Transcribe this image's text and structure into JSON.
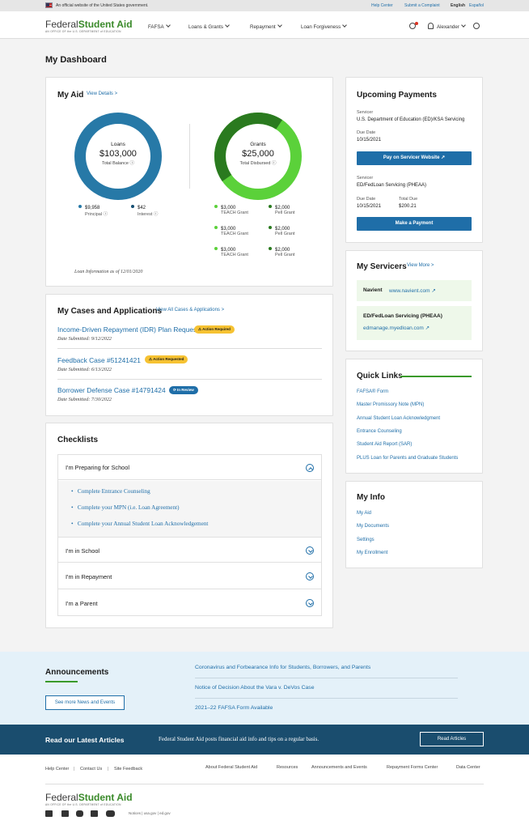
{
  "gov_banner": {
    "text": "An official website of the United States government.",
    "help": "Help Center",
    "complaint": "Submit a Complaint",
    "english": "English",
    "espanol": "Español"
  },
  "nav": {
    "logo_a": "Federal",
    "logo_b": "Student Aid",
    "logo_sub": "AN OFFICE OF the U.S. DEPARTMENT of EDUCATION",
    "items": [
      "FAFSA",
      "Loans & Grants",
      "Repayment",
      "Loan Forgiveness"
    ],
    "user": "Alexander"
  },
  "page_title": "My Dashboard",
  "my_aid": {
    "title": "My Aid",
    "view_details": "View Details >",
    "loans": {
      "title": "Loans",
      "amount": "$103,000",
      "sub": "Total Balance",
      "principal": "$9,958",
      "principal_l": "Principal",
      "interest": "$42",
      "interest_l": "Interest"
    },
    "grants": {
      "title": "Grants",
      "amount": "$25,000",
      "sub": "Total Disbursed",
      "items": [
        {
          "v": "$3,000",
          "l": "TEACH Grant"
        },
        {
          "v": "$2,000",
          "l": "Pell Grant"
        },
        {
          "v": "$3,000",
          "l": "TEACH Grant"
        },
        {
          "v": "$2,000",
          "l": "Pell Grant"
        },
        {
          "v": "$3,000",
          "l": "TEACH Grant"
        },
        {
          "v": "$2,000",
          "l": "Pell Grant"
        }
      ]
    },
    "info_date": "Loan Information as of 12/01/2020",
    "colors": {
      "loan": "#2779a7",
      "loan_dark": "#164f73",
      "grant_light": "#5bd13a",
      "grant_dark": "#2a7a1f"
    }
  },
  "cases": {
    "title": "My Cases and Applications",
    "view_all": "View All Cases & Applications >",
    "items": [
      {
        "title": "Income-Driven Repayment (IDR) Plan Request",
        "badge": "Action Required",
        "date": "Date Submitted: 9/12/2022"
      },
      {
        "title": "Feedback Case #51241421",
        "badge": "Action Requested",
        "date": "Date Submitted: 6/13/2022"
      },
      {
        "title": "Borrower Defense Case #14791424",
        "badge": "In Review",
        "date": "Date Submitted: 7/30/2022"
      }
    ]
  },
  "checklists": {
    "title": "Checklists",
    "sections": [
      "I'm Preparing for School",
      "I'm in School",
      "I'm in Repayment",
      "I'm a Parent"
    ],
    "items": [
      "Complete Entrance Counseling",
      "Complete your MPN (i.e. Loan Agreement)",
      "Complete your Annual Student Loan Acknowledgement"
    ]
  },
  "payments": {
    "title": "Upcoming Payments",
    "s1_label": "Servicer",
    "s1": "U.S. Department of Education (ED)/KSA Servicing",
    "d1_label": "Due Date",
    "d1": "10/15/2021",
    "btn1": "Pay on Servicer Website",
    "s2_label": "Servicer",
    "s2": "ED/FedLoan Servicing (PHEAA)",
    "d2_label": "Due Date",
    "d2": "10/15/2021",
    "t2_label": "Total Due",
    "t2": "$200.21",
    "btn2": "Make a Payment"
  },
  "servicers": {
    "title": "My Servicers",
    "view_more": "View More >",
    "n1": "Navient",
    "u1": "www.navient.com",
    "n2": "ED/FedLoan Servicing (PHEAA)",
    "u2": "edmanage.myedloan.com"
  },
  "quick_links": {
    "title": "Quick Links",
    "items": [
      "FAFSA® Form",
      "Master Promissory Note (MPN)",
      "Annual Student Loan Acknowledgment",
      "Entrance Counseling",
      "Student Aid Report (SAR)",
      "PLUS Loan for Parents and Graduate Students"
    ]
  },
  "my_info": {
    "title": "My Info",
    "items": [
      "My Aid",
      "My Documents",
      "Settings",
      "My Enrollment"
    ]
  },
  "announcements": {
    "title": "Announcements",
    "btn": "See more News and Events",
    "items": [
      "Coronavirus and Forbearance Info for Students, Borrowers, and Parents",
      "Notice of Decision About the Vara v. DeVos Case",
      "2021–22 FAFSA Form Available"
    ]
  },
  "articles": {
    "title": "Read our Latest Articles",
    "text": "Federal Student Aid posts financial aid info and tips on a regular basis.",
    "btn": "Read Articles"
  },
  "footer": {
    "left": [
      "Help Center",
      "Contact Us",
      "Site Feedback"
    ],
    "right": [
      "About Federal Student Aid",
      "Resources",
      "Announcements and Events",
      "Repayment Forms Center",
      "Data Center"
    ],
    "bottom": "Notices | usa.gov | ed.gov"
  }
}
